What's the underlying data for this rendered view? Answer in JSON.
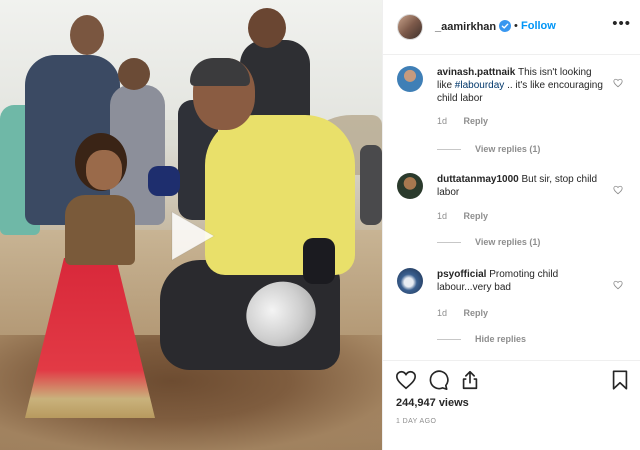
{
  "header": {
    "username": "_aamirkhan",
    "separator": "•",
    "follow_label": "Follow",
    "more_label": "•••"
  },
  "comments": [
    {
      "username": "avinash.pattnaik",
      "text_before": "This isn't looking like",
      "hashtag": "#labourday",
      "text_after": ".. it's like encouraging child labor",
      "age": "1d",
      "reply_label": "Reply",
      "replies_label": "View replies (1)"
    },
    {
      "username": "duttatanmay1000",
      "text": "But sir, stop child labor",
      "age": "1d",
      "reply_label": "Reply",
      "replies_label": "View replies (1)"
    },
    {
      "username": "psyofficial",
      "text": "Promoting child labour...very bad",
      "age": "1d",
      "reply_label": "Reply",
      "replies_label": "Hide replies"
    }
  ],
  "footer": {
    "views": "244,947 views",
    "timestamp": "1 DAY AGO"
  },
  "icons": {
    "verified": "verified-badge-icon",
    "like": "heart-icon",
    "comment": "comment-bubble-icon",
    "share": "share-icon",
    "save": "bookmark-icon",
    "play": "play-icon"
  },
  "colors": {
    "link_blue": "#0095f6",
    "hashtag": "#00376b",
    "muted": "#8e8e8e",
    "text": "#262626"
  }
}
